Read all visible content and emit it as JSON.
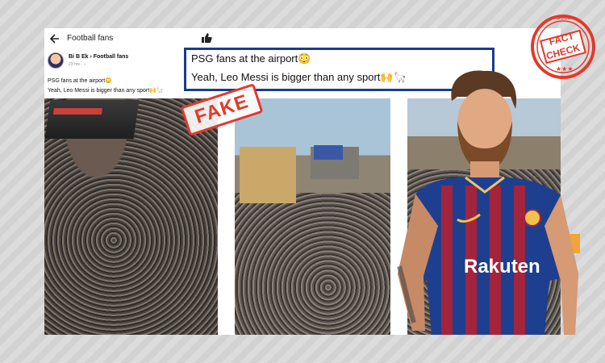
{
  "header": {
    "group_title": "Football fans"
  },
  "post": {
    "author": "Bi B Ek › Football fans",
    "meta": "23 hrs · ♁",
    "line1": "PSG fans at the airport😳",
    "line2": "Yeah, Leo Messi is bigger than any sport🙌🦙"
  },
  "caption": {
    "line1": "PSG fans at the airport😳",
    "line2": "Yeah, Leo Messi is bigger than any sport🙌🦙"
  },
  "stamp": {
    "label": "FAKE"
  },
  "logo": {
    "top_word": "BOOM",
    "word1": "FACT",
    "word2": "CHECK"
  },
  "jersey": {
    "sponsor": "Rakuten"
  },
  "colors": {
    "stamp_red": "#e23a2b",
    "caption_border": "#1a3c8c",
    "jersey_blue": "#1e3f8f",
    "jersey_red": "#a3243d"
  }
}
